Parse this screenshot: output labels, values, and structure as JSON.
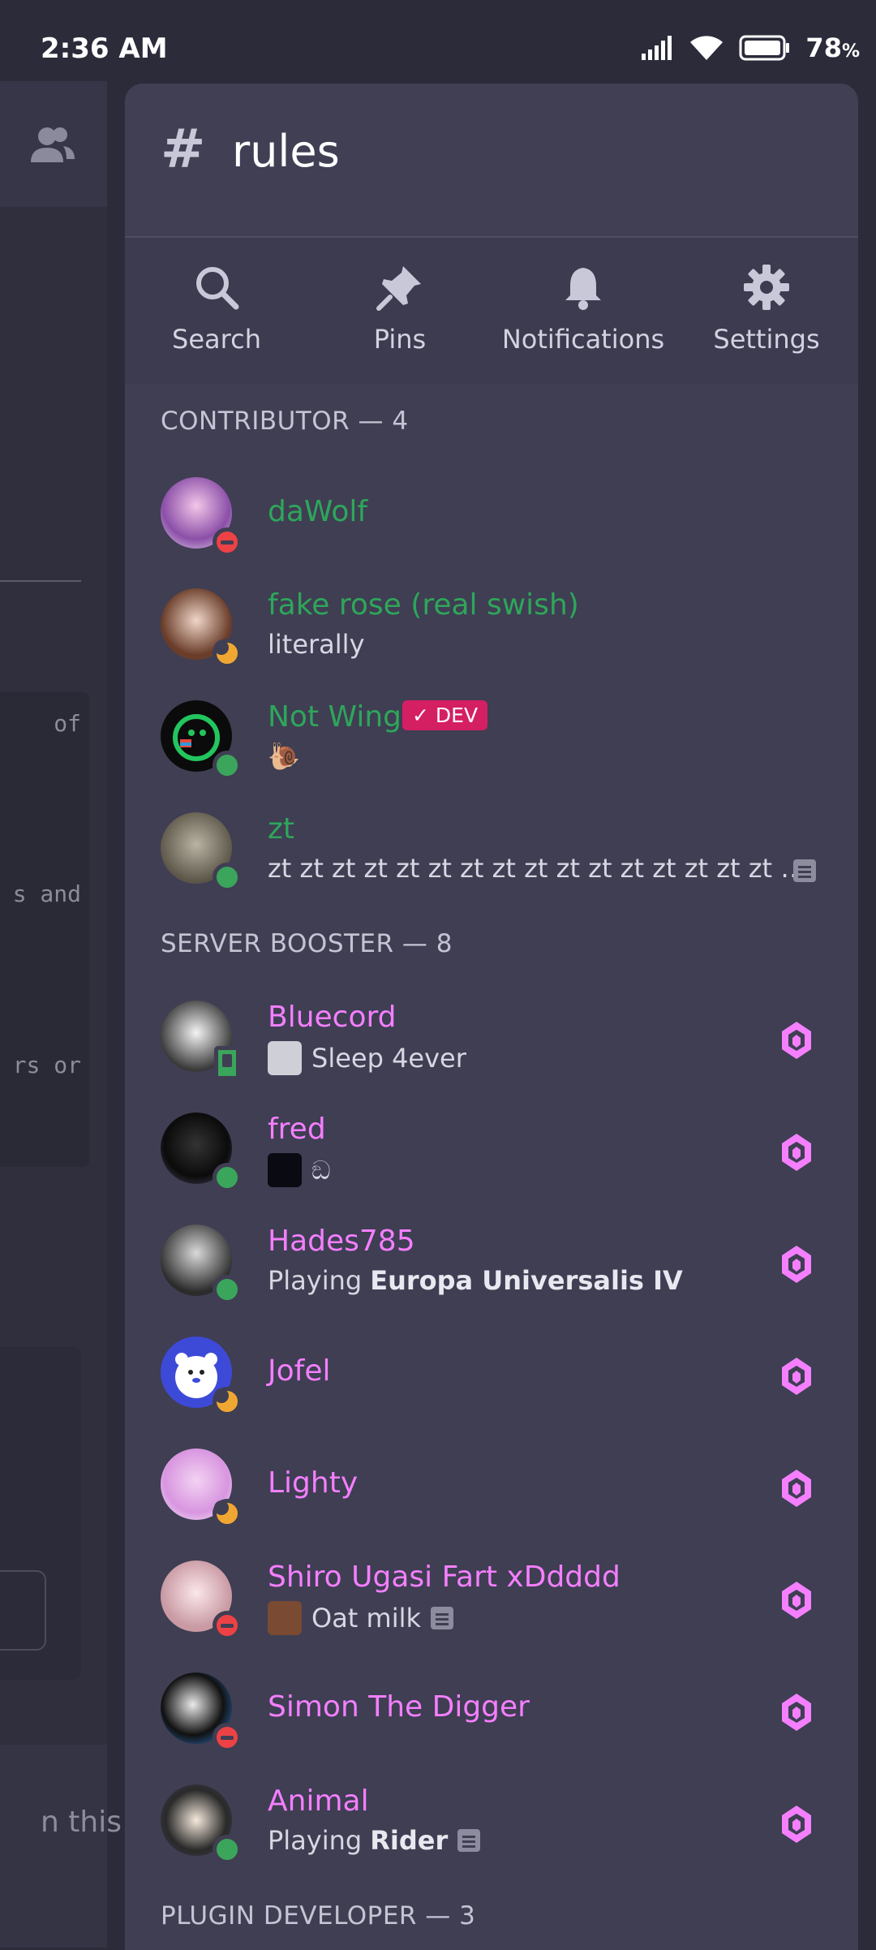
{
  "status_bar": {
    "time": "2:36 AM",
    "battery": "78",
    "battery_unit": "%"
  },
  "background": {
    "code_lines": [
      "of",
      "s and",
      "rs or"
    ],
    "bottom_text": "n this"
  },
  "channel": {
    "hash": "#",
    "name": "rules"
  },
  "toolbar": {
    "search": "Search",
    "pins": "Pins",
    "notifications": "Notifications",
    "settings": "Settings"
  },
  "sections": {
    "contributor": "CONTRIBUTOR — 4",
    "booster": "SERVER BOOSTER — 8",
    "plugin": "PLUGIN DEVELOPER — 3"
  },
  "contributors": [
    {
      "name": "daWolf",
      "status": "dnd"
    },
    {
      "name": "fake rose (real swish)",
      "activity": "literally",
      "status": "idle"
    },
    {
      "name": "Not Wing",
      "badge": "✓ DEV",
      "activity": "🐌",
      "status": "online"
    },
    {
      "name": "zt",
      "activity": "zt zt zt zt zt zt zt zt zt zt zt zt zt zt zt zt …",
      "status": "online"
    }
  ],
  "boosters": [
    {
      "name": "Bluecord",
      "activity": "Sleep 4ever",
      "status": "mobile"
    },
    {
      "name": "fred",
      "activity": "ඞ",
      "status": "online"
    },
    {
      "name": "Hades785",
      "activity_prefix": "Playing",
      "activity": "Europa Universalis IV",
      "status": "online"
    },
    {
      "name": "Jofel",
      "status": "idle"
    },
    {
      "name": "Lighty",
      "status": "idle"
    },
    {
      "name": "Shiro Ugasi Fart xDdddd",
      "activity": "Oat milk",
      "status": "dnd"
    },
    {
      "name": "Simon The Digger",
      "status": "dnd"
    },
    {
      "name": "Animal",
      "activity_prefix": "Playing",
      "activity": "Rider",
      "status": "online"
    }
  ],
  "colors": {
    "contributor_name": "#2ea65a",
    "booster_name": "#f47fff",
    "online": "#3ba55c",
    "dnd": "#ed4245",
    "idle": "#f0a732",
    "dev_badge": "#d51f63"
  }
}
